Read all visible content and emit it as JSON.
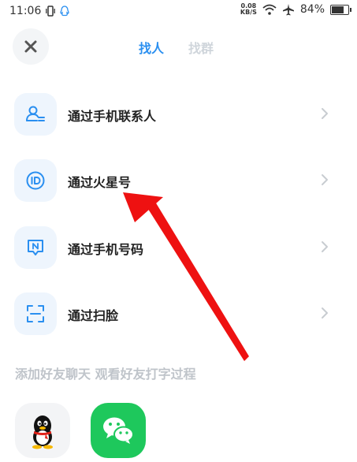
{
  "status_bar": {
    "time": "11:06",
    "net_speed_value": "0.08",
    "net_speed_unit": "KB/S",
    "battery_percent": "84%",
    "battery_level": 0.84
  },
  "header": {
    "tabs": [
      {
        "label": "找人",
        "active": true
      },
      {
        "label": "找群",
        "active": false
      }
    ]
  },
  "menu": {
    "items": [
      {
        "label": "通过手机联系人",
        "icon": "contact-icon"
      },
      {
        "label": "通过火星号",
        "icon": "id-icon"
      },
      {
        "label": "通过手机号码",
        "icon": "phone-number-icon"
      },
      {
        "label": "通过扫脸",
        "icon": "face-scan-icon"
      }
    ]
  },
  "share": {
    "title": "添加好友聊天 观看好友打字过程",
    "apps": [
      {
        "app": "qq",
        "icon": "qq-penguin-icon"
      },
      {
        "app": "wechat",
        "icon": "wechat-icon"
      }
    ]
  },
  "colors": {
    "accent": "#2a8ff0",
    "inactive_tab": "#cfd5db",
    "icon_bg": "#eef5fd",
    "wechat_green": "#1ec85c",
    "annotation_red": "#ee1111"
  }
}
